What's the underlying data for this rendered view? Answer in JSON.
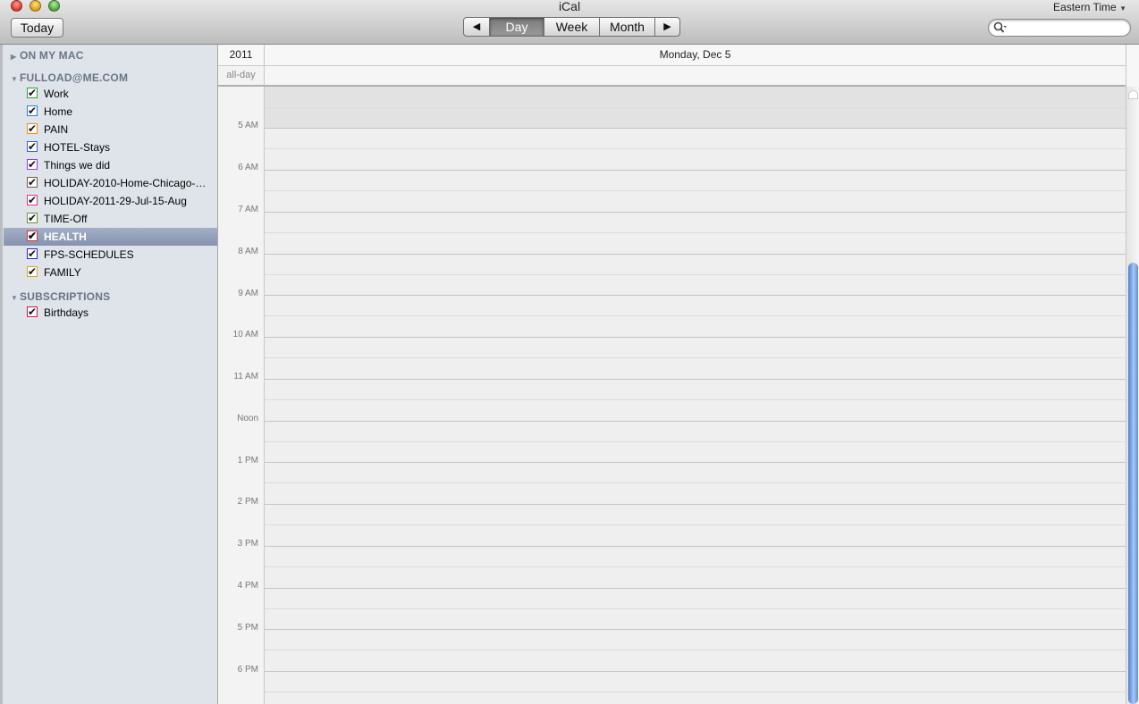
{
  "window": {
    "title": "iCal"
  },
  "toolbar": {
    "today_label": "Today",
    "prev_icon": "◀",
    "next_icon": "▶",
    "views": [
      "Day",
      "Week",
      "Month"
    ],
    "selected_view": "Day",
    "timezone_label": "Eastern Time",
    "search_placeholder": ""
  },
  "sidebar": {
    "groups": [
      {
        "label": "ON MY MAC",
        "expanded": false
      },
      {
        "label": "FULLOAD@ME.COM",
        "expanded": true
      },
      {
        "label": "SUBSCRIPTIONS",
        "expanded": true
      }
    ],
    "calendars": [
      {
        "label": "Work",
        "color": "#29a329",
        "checked": true
      },
      {
        "label": "Home",
        "color": "#2b7fd6",
        "checked": true
      },
      {
        "label": "PAIN",
        "color": "#f08a10",
        "checked": true
      },
      {
        "label": "HOTEL-Stays",
        "color": "#2b65c8",
        "checked": true
      },
      {
        "label": "Things we did",
        "color": "#8a3fd1",
        "checked": true
      },
      {
        "label": "HOLIDAY-2010-Home-Chicago-…",
        "color": "#7a5c3e",
        "checked": true
      },
      {
        "label": "HOLIDAY-2011-29-Jul-15-Aug",
        "color": "#e0338a",
        "checked": true
      },
      {
        "label": "TIME-Off",
        "color": "#6f8f3a",
        "checked": true
      },
      {
        "label": "HEALTH",
        "color": "#e03030",
        "checked": true,
        "selected": true
      },
      {
        "label": "FPS-SCHEDULES",
        "color": "#2a2ab8",
        "checked": true
      },
      {
        "label": "FAMILY",
        "color": "#d8a520",
        "checked": true
      }
    ],
    "subscriptions": [
      {
        "label": "Birthdays",
        "color": "#d0185a",
        "checked": true
      }
    ]
  },
  "calendar": {
    "year": "2011",
    "day_header": "Monday, Dec 5",
    "allday_label": "all-day",
    "hours": [
      "5 AM",
      "6 AM",
      "7 AM",
      "8 AM",
      "9 AM",
      "10 AM",
      "11 AM",
      "Noon",
      "1 PM",
      "2 PM",
      "3 PM",
      "4 PM",
      "5 PM",
      "6 PM"
    ]
  }
}
